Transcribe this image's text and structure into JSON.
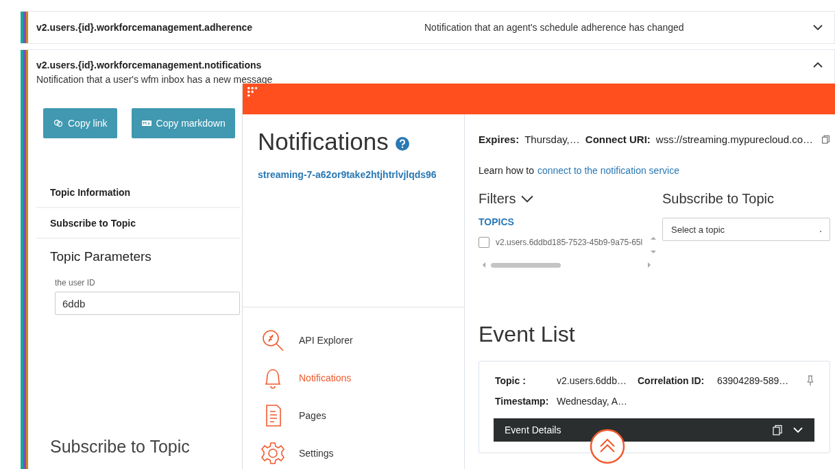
{
  "topics": [
    {
      "title": "v2.users.{id}.workforcemanagement.adherence",
      "description": "Notification that an agent's schedule adherence has changed",
      "expanded": false
    },
    {
      "title": "v2.users.{id}.workforcemanagement.notifications",
      "description": "Notification that a user's wfm inbox has a new message",
      "expanded": true,
      "buttons": [
        {
          "label": "Copy link",
          "kind": "link"
        },
        {
          "label": "Copy markdown",
          "kind": "markdown"
        }
      ],
      "sections": [
        "Topic Information",
        "Subscribe to Topic"
      ],
      "parameters_heading": "Topic Parameters",
      "parameter": {
        "label": "the user ID",
        "value": "6ddb"
      },
      "subscribe_heading": "Subscribe to Topic"
    }
  ],
  "panel": {
    "title": "Notifications",
    "channel_id": "streaming-7-a62or9take2htjhtrlvjlqds96",
    "nav": [
      {
        "label": "API Explorer",
        "kind": "explorer",
        "selected": false
      },
      {
        "label": "Notifications",
        "kind": "bell",
        "selected": true
      },
      {
        "label": "Pages",
        "kind": "page",
        "selected": false
      },
      {
        "label": "Settings",
        "kind": "gear",
        "selected": false
      }
    ],
    "expires_label": "Expires:",
    "expires": "Thursday,…",
    "uri_label": "Connect URI:",
    "uri": "wss://streaming.mypurecloud.co…",
    "learn_text": "Learn how to",
    "learn_link": "connect to the notification service",
    "filters": "Filters",
    "topics_label": "TOPICS",
    "topic_filters": [
      {
        "label": "v2.users.6ddbd185-7523-45b9-9a75-65l",
        "checked": false
      }
    ],
    "subscribe_heading": "Subscribe to Topic",
    "select_placeholder": "Select a topic",
    "event_list": "Event List",
    "events": [
      {
        "topic_label": "Topic :",
        "topic": "v2.users.6ddb…",
        "correlation_label": "Correlation ID:",
        "correlation": "63904289-589…",
        "timestamp_label": "Timestamp:",
        "timestamp": "Wednesday, A…",
        "details": "Event Details"
      }
    ]
  }
}
